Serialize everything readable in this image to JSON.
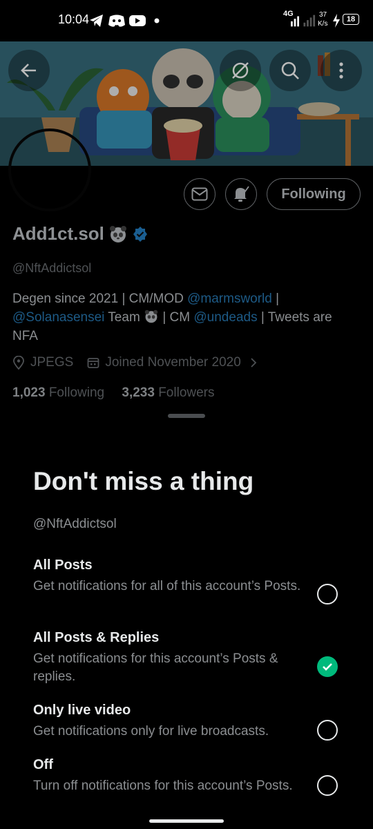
{
  "status_bar": {
    "time": "10:04",
    "network": "4G",
    "speed_value": "37",
    "speed_unit": "K/s",
    "battery": "18"
  },
  "colors": {
    "accent": "#1d9bf0",
    "check_green": "#00ba7c",
    "sheet_bg": "#000000"
  },
  "profile": {
    "name": "Add1ct.sol",
    "handle": "@NftAddictsol",
    "bio_parts": [
      "Degen since 2021 | CM/MOD ",
      "@marmsworld",
      " | ",
      "@Solanasensei",
      " Team ",
      " | CM ",
      "@undeads",
      " | Tweets are NFA"
    ],
    "location": "JPEGS",
    "joined": "Joined November 2020",
    "following_count": "1,023",
    "following_label": "Following",
    "followers_count": "3,233",
    "followers_label": "Followers",
    "follow_button_label": "Following"
  },
  "sheet": {
    "title": "Don't miss a thing",
    "handle": "@NftAddictsol",
    "options": [
      {
        "title": "All Posts",
        "desc": "Get notifications for all of this account’s Posts.",
        "selected": false
      },
      {
        "title": "All Posts & Replies",
        "desc": "Get notifications for this account’s Posts & replies.",
        "selected": true
      },
      {
        "title": "Only live video",
        "desc": "Get notifications only for live broadcasts.",
        "selected": false
      },
      {
        "title": "Off",
        "desc": "Turn off notifications for this account’s Posts.",
        "selected": false
      }
    ]
  },
  "icons": [
    "back-arrow-icon",
    "grok-icon",
    "search-icon",
    "more-vert-icon",
    "mail-icon",
    "bell-check-icon",
    "verified-badge-icon",
    "location-icon",
    "calendar-icon",
    "chevron-right-icon",
    "check-icon"
  ]
}
